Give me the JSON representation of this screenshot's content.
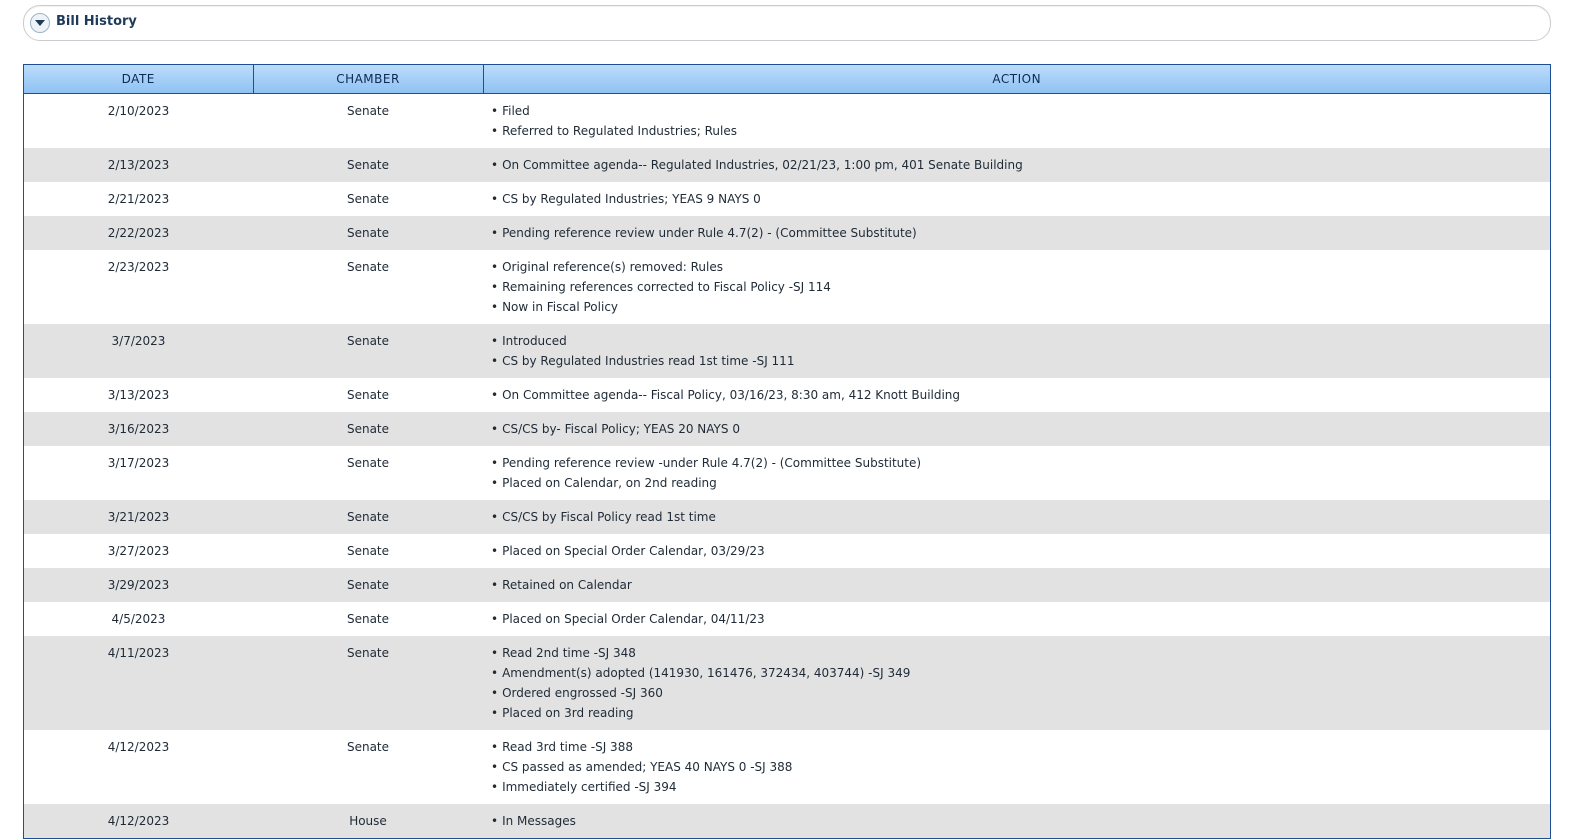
{
  "section": {
    "title": "Bill History",
    "toggle_icon": "chevron-down-icon"
  },
  "table": {
    "headers": [
      "DATE",
      "CHAMBER",
      "ACTION"
    ],
    "rows": [
      {
        "date": "2/10/2023",
        "chamber": "Senate",
        "actions": [
          "Filed",
          "Referred to Regulated Industries; Rules"
        ]
      },
      {
        "date": "2/13/2023",
        "chamber": "Senate",
        "actions": [
          "On Committee agenda-- Regulated Industries, 02/21/23, 1:00 pm, 401 Senate Building"
        ]
      },
      {
        "date": "2/21/2023",
        "chamber": "Senate",
        "actions": [
          "CS by Regulated Industries; YEAS 9 NAYS 0"
        ]
      },
      {
        "date": "2/22/2023",
        "chamber": "Senate",
        "actions": [
          "Pending reference review under Rule 4.7(2) - (Committee Substitute)"
        ]
      },
      {
        "date": "2/23/2023",
        "chamber": "Senate",
        "actions": [
          "Original reference(s) removed: Rules",
          "Remaining references corrected to Fiscal Policy -SJ 114",
          "Now in Fiscal Policy"
        ]
      },
      {
        "date": "3/7/2023",
        "chamber": "Senate",
        "actions": [
          "Introduced",
          "CS by Regulated Industries read 1st time -SJ 111"
        ]
      },
      {
        "date": "3/13/2023",
        "chamber": "Senate",
        "actions": [
          "On Committee agenda-- Fiscal Policy, 03/16/23, 8:30 am, 412 Knott Building"
        ]
      },
      {
        "date": "3/16/2023",
        "chamber": "Senate",
        "actions": [
          "CS/CS by- Fiscal Policy; YEAS 20 NAYS 0"
        ]
      },
      {
        "date": "3/17/2023",
        "chamber": "Senate",
        "actions": [
          "Pending reference review -under Rule 4.7(2) - (Committee Substitute)",
          "Placed on Calendar, on 2nd reading"
        ]
      },
      {
        "date": "3/21/2023",
        "chamber": "Senate",
        "actions": [
          "CS/CS by Fiscal Policy read 1st time"
        ]
      },
      {
        "date": "3/27/2023",
        "chamber": "Senate",
        "actions": [
          "Placed on Special Order Calendar, 03/29/23"
        ]
      },
      {
        "date": "3/29/2023",
        "chamber": "Senate",
        "actions": [
          "Retained on Calendar"
        ]
      },
      {
        "date": "4/5/2023",
        "chamber": "Senate",
        "actions": [
          "Placed on Special Order Calendar, 04/11/23"
        ]
      },
      {
        "date": "4/11/2023",
        "chamber": "Senate",
        "actions": [
          "Read 2nd time -SJ 348",
          "Amendment(s) adopted (141930, 161476, 372434, 403744) -SJ 349",
          "Ordered engrossed -SJ 360",
          "Placed on 3rd reading"
        ]
      },
      {
        "date": "4/12/2023",
        "chamber": "Senate",
        "actions": [
          "Read 3rd time -SJ 388",
          "CS passed as amended; YEAS 40 NAYS 0 -SJ 388",
          "Immediately certified -SJ 394"
        ]
      },
      {
        "date": "4/12/2023",
        "chamber": "House",
        "actions": [
          "In Messages"
        ]
      }
    ]
  }
}
